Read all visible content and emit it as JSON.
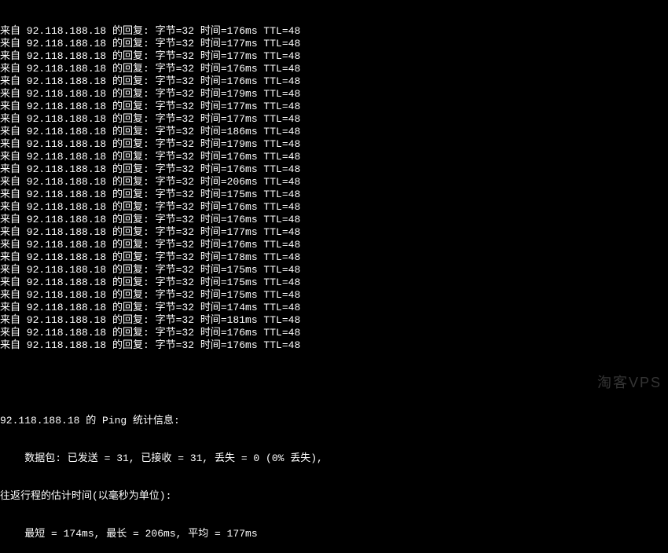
{
  "ping": {
    "ip": "92.118.188.18",
    "bytes": "32",
    "ttl": "48",
    "prefix": "来自 ",
    "reply_label": " 的回复: 字节=",
    "time_label": " 时间=",
    "ttl_label": " TTL=",
    "replies": [
      {
        "time": "176ms"
      },
      {
        "time": "177ms"
      },
      {
        "time": "177ms"
      },
      {
        "time": "176ms"
      },
      {
        "time": "176ms"
      },
      {
        "time": "179ms"
      },
      {
        "time": "177ms"
      },
      {
        "time": "177ms"
      },
      {
        "time": "186ms"
      },
      {
        "time": "179ms"
      },
      {
        "time": "176ms"
      },
      {
        "time": "176ms"
      },
      {
        "time": "206ms"
      },
      {
        "time": "175ms"
      },
      {
        "time": "176ms"
      },
      {
        "time": "176ms"
      },
      {
        "time": "177ms"
      },
      {
        "time": "176ms"
      },
      {
        "time": "178ms"
      },
      {
        "time": "175ms"
      },
      {
        "time": "175ms"
      },
      {
        "time": "175ms"
      },
      {
        "time": "174ms"
      },
      {
        "time": "181ms"
      },
      {
        "time": "176ms"
      },
      {
        "time": "176ms"
      }
    ],
    "truncated_first": {
      "time_partial": "176ms",
      "ttl_partial": ". TTL=48"
    }
  },
  "stats": {
    "title_1": " 的 Ping 统计信息:",
    "packets": "    数据包: 已发送 = 31, 已接收 = 31, 丢失 = 0 (0% 丢失),",
    "rtt_label": "往返行程的估计时间(以毫秒为单位):",
    "rtt_values": "    最短 = 174ms, 最长 = 206ms, 平均 = 177ms",
    "sent": "31",
    "received": "31",
    "lost": "0",
    "loss_pct": "0%",
    "min": "174ms",
    "max": "206ms",
    "avg": "177ms"
  },
  "watermark": "淘客VPS"
}
